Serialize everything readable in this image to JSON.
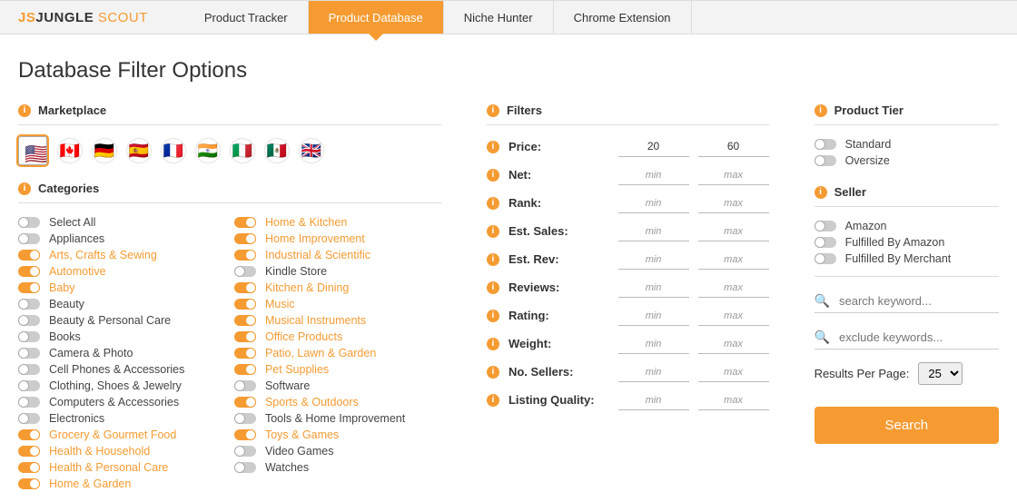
{
  "brand": {
    "js": "JS",
    "name": "JUNGLE",
    "scout": "SCOUT"
  },
  "nav": [
    "Product Tracker",
    "Product Database",
    "Niche Hunter",
    "Chrome Extension"
  ],
  "nav_active": 1,
  "title": "Database Filter Options",
  "marketplace_label": "Marketplace",
  "flags": [
    "🇺🇸",
    "🇨🇦",
    "🇩🇪",
    "🇪🇸",
    "🇫🇷",
    "🇮🇳",
    "🇮🇹",
    "🇲🇽",
    "🇬🇧"
  ],
  "flag_selected": 0,
  "categories_label": "Categories",
  "categories": [
    {
      "label": "Select All",
      "on": false
    },
    {
      "label": "Appliances",
      "on": false
    },
    {
      "label": "Arts, Crafts & Sewing",
      "on": true
    },
    {
      "label": "Automotive",
      "on": true
    },
    {
      "label": "Baby",
      "on": true
    },
    {
      "label": "Beauty",
      "on": false
    },
    {
      "label": "Beauty & Personal Care",
      "on": false
    },
    {
      "label": "Books",
      "on": false
    },
    {
      "label": "Camera & Photo",
      "on": false
    },
    {
      "label": "Cell Phones & Accessories",
      "on": false
    },
    {
      "label": "Clothing, Shoes & Jewelry",
      "on": false
    },
    {
      "label": "Computers & Accessories",
      "on": false
    },
    {
      "label": "Electronics",
      "on": false
    },
    {
      "label": "Grocery & Gourmet Food",
      "on": true
    },
    {
      "label": "Health & Household",
      "on": true
    },
    {
      "label": "Health & Personal Care",
      "on": true
    },
    {
      "label": "Home & Garden",
      "on": true
    },
    {
      "label": "Home & Kitchen",
      "on": true
    },
    {
      "label": "Home Improvement",
      "on": true
    },
    {
      "label": "Industrial & Scientific",
      "on": true
    },
    {
      "label": "Kindle Store",
      "on": false
    },
    {
      "label": "Kitchen & Dining",
      "on": true
    },
    {
      "label": "Music",
      "on": true
    },
    {
      "label": "Musical Instruments",
      "on": true
    },
    {
      "label": "Office Products",
      "on": true
    },
    {
      "label": "Patio, Lawn & Garden",
      "on": true
    },
    {
      "label": "Pet Supplies",
      "on": true
    },
    {
      "label": "Software",
      "on": false
    },
    {
      "label": "Sports & Outdoors",
      "on": true
    },
    {
      "label": "Tools & Home Improvement",
      "on": false
    },
    {
      "label": "Toys & Games",
      "on": true
    },
    {
      "label": "Video Games",
      "on": false
    },
    {
      "label": "Watches",
      "on": false
    }
  ],
  "filters_label": "Filters",
  "filters": [
    {
      "label": "Price:",
      "min": "20",
      "max": "60"
    },
    {
      "label": "Net:",
      "min": "",
      "max": ""
    },
    {
      "label": "Rank:",
      "min": "",
      "max": ""
    },
    {
      "label": "Est. Sales:",
      "min": "",
      "max": ""
    },
    {
      "label": "Est. Rev:",
      "min": "",
      "max": ""
    },
    {
      "label": "Reviews:",
      "min": "",
      "max": ""
    },
    {
      "label": "Rating:",
      "min": "",
      "max": ""
    },
    {
      "label": "Weight:",
      "min": "",
      "max": ""
    },
    {
      "label": "No. Sellers:",
      "min": "",
      "max": ""
    },
    {
      "label": "Listing Quality:",
      "min": "",
      "max": ""
    }
  ],
  "placeholder_min": "min",
  "placeholder_max": "max",
  "tier_label": "Product Tier",
  "tier_opts": [
    {
      "label": "Standard"
    },
    {
      "label": "Oversize"
    }
  ],
  "seller_label": "Seller",
  "seller_opts": [
    {
      "label": "Amazon"
    },
    {
      "label": "Fulfilled By Amazon"
    },
    {
      "label": "Fulfilled By Merchant"
    }
  ],
  "search_placeholder": "search keyword...",
  "exclude_placeholder": "exclude keywords...",
  "rpp_label": "Results Per Page:",
  "rpp_value": "25",
  "search_btn": "Search"
}
